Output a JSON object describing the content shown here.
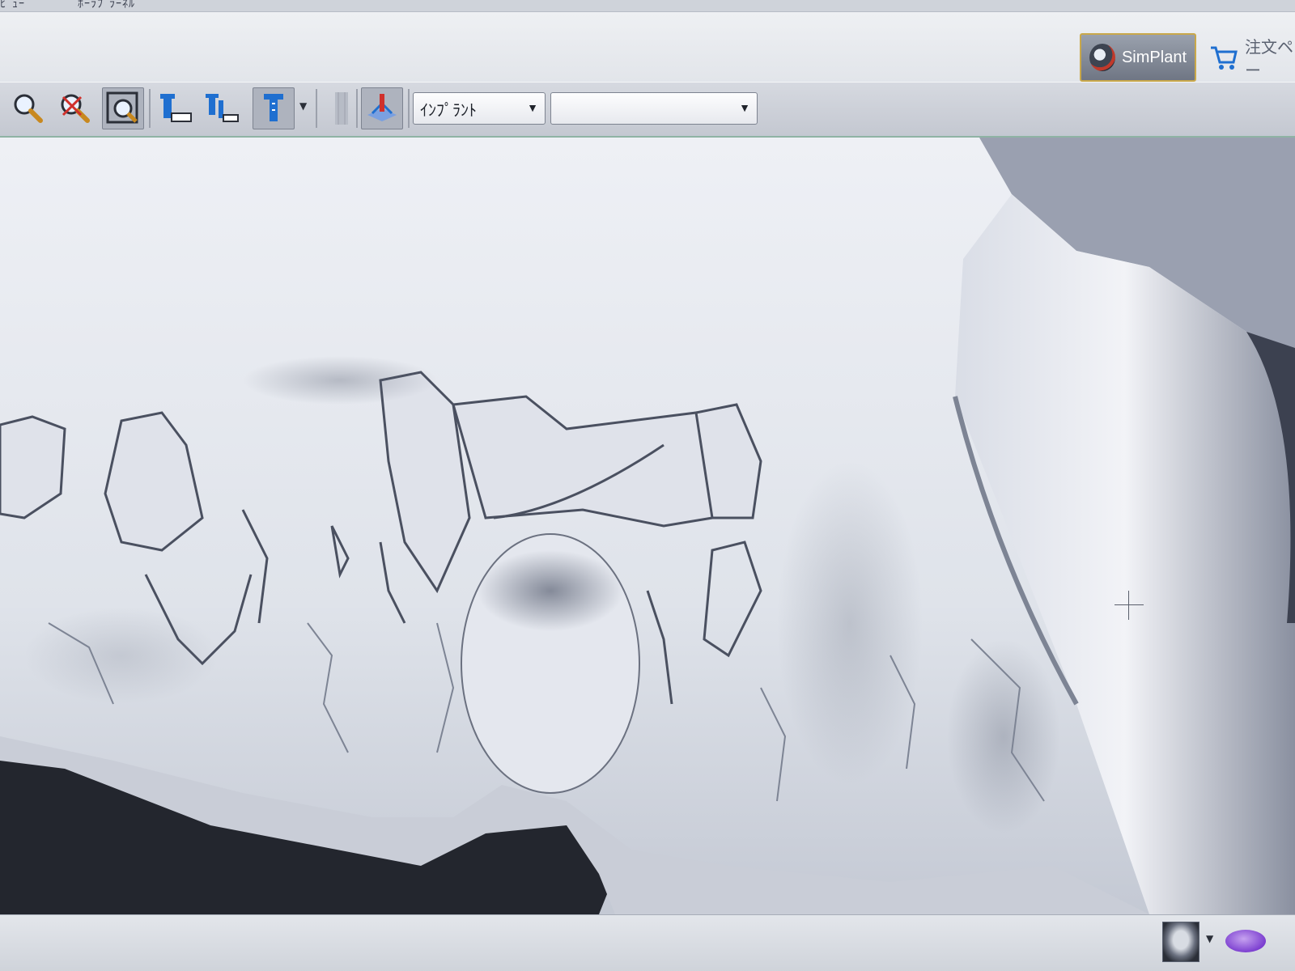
{
  "menu": {
    "items": [
      "ﾋﾞｭｰ",
      "ﾎｰﾗﾌﾞﾗｰﾈﾙ"
    ]
  },
  "modules": {
    "active_label": "SimPlant",
    "other_label": "注文ペー"
  },
  "toolbar": {
    "tools": [
      {
        "icon": "zoom-icon"
      },
      {
        "icon": "zoom-reset-icon"
      },
      {
        "icon": "zoom-window-icon"
      },
      {
        "icon": "implant-place-icon"
      },
      {
        "icon": "implant-align-icon"
      },
      {
        "icon": "implant-tool-icon"
      },
      {
        "icon": "grid-icon"
      },
      {
        "icon": "nerve-icon"
      }
    ],
    "object_combo_value": "ｲﾝﾌﾟﾗﾝﾄ",
    "item_combo_value": ""
  },
  "status": {
    "thumbnail_icon": "skull-render-icon",
    "color_icon": "purple-object-icon"
  },
  "colors": {
    "accent_border": "#c9a84a",
    "toolbar_bottom": "#8fb3a4",
    "bone": "#eceef3"
  }
}
